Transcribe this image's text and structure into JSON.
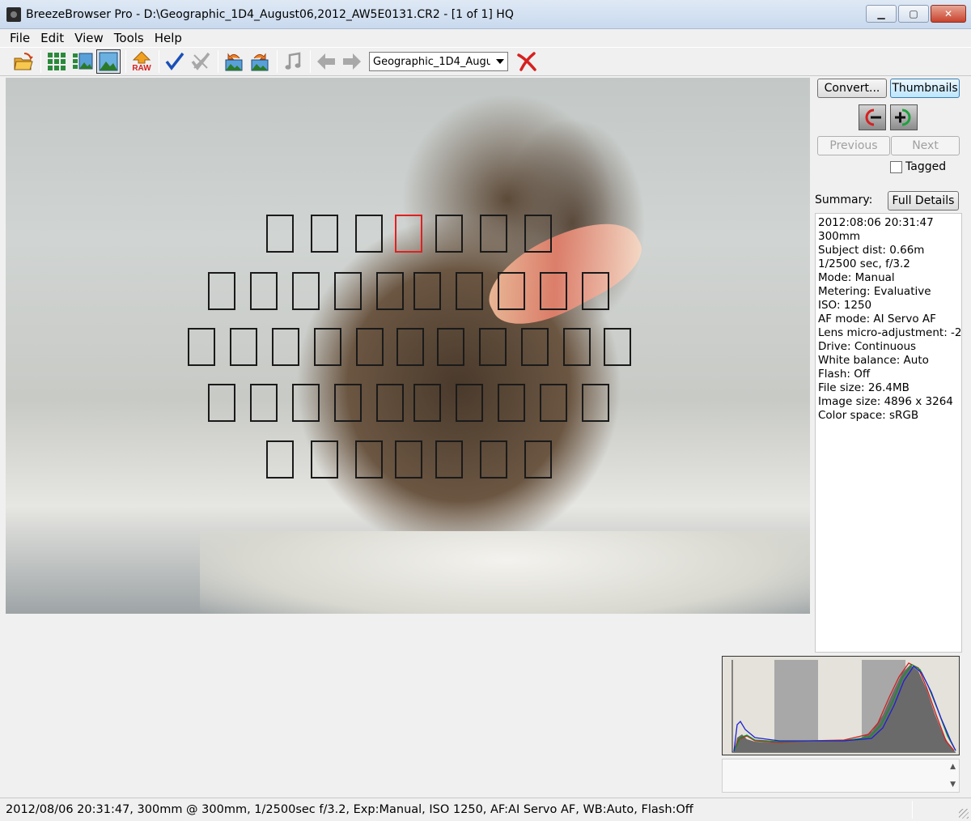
{
  "window": {
    "title": "BreezeBrowser Pro - D:\\Geographic_1D4_August06,2012_AW5E0131.CR2 - [1 of 1] HQ",
    "minimize": "▁",
    "maximize": "▢",
    "close": "✕"
  },
  "menu": {
    "items": [
      "File",
      "Edit",
      "View",
      "Tools",
      "Help"
    ]
  },
  "toolbar": {
    "icons": [
      "open-folder-icon",
      "thumbnail-grid-icon",
      "filmstrip-view-icon",
      "single-image-view-icon",
      "raw-convert-icon",
      "tag-check-icon",
      "untag-icon",
      "rotate-left-icon",
      "rotate-right-icon",
      "audio-note-icon",
      "back-arrow-icon",
      "forward-arrow-icon",
      "delete-icon"
    ],
    "file_select": "Geographic_1D4_Augu",
    "raw_label": "RAW",
    "colors": {
      "accent_red": "#d62020",
      "check_blue": "#1a4fb8",
      "arrow_gray": "#9a9a9a"
    }
  },
  "af_points": {
    "selected_color": "#e02020",
    "normal_color": "#1a1a1a"
  },
  "panel": {
    "convert_label": "Convert...",
    "thumbnails_label": "Thumbnails",
    "previous_label": "Previous",
    "next_label": "Next",
    "tagged_label": "Tagged",
    "summary_label": "Summary:",
    "full_details_label": "Full Details"
  },
  "summary": [
    "2012:08:06 20:31:47",
    "300mm",
    "Subject dist: 0.66m",
    "1/2500 sec, f/3.2",
    "Mode: Manual",
    "Metering: Evaluative",
    "ISO: 1250",
    "AF mode: AI Servo AF",
    "Lens micro-adjustment: -2",
    "Drive: Continuous",
    "White balance: Auto",
    "Flash: Off",
    "File size: 26.4MB",
    "Image size: 4896 x 3264",
    "Color space: sRGB"
  ],
  "histogram": {
    "series_colors": {
      "red": "#d02020",
      "green": "#109030",
      "blue": "#2020d0",
      "luminance": "#6a6a6a"
    }
  },
  "status": {
    "text": "2012/08/06 20:31:47, 300mm @ 300mm, 1/2500sec f/3.2, Exp:Manual, ISO 1250, AF:AI Servo AF, WB:Auto, Flash:Off"
  }
}
